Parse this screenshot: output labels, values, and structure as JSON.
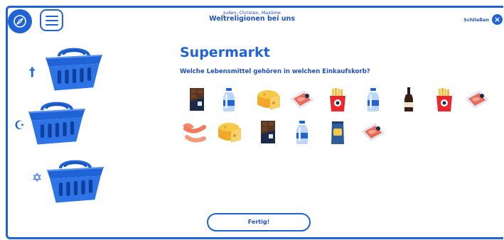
{
  "header": {
    "subtitle": "Juden, Christen, Muslime",
    "title": "Weltreligionen bei uns",
    "close_label": "Schließen",
    "close_glyph": "×"
  },
  "icons": {
    "compass": "compass-icon",
    "menu": "hamburger-menu-icon",
    "close": "close-icon"
  },
  "baskets": [
    {
      "symbol": "†",
      "religion": "christian"
    },
    {
      "symbol": "☪",
      "religion": "muslim"
    },
    {
      "symbol": "✡",
      "religion": "jewish"
    }
  ],
  "main": {
    "title": "Supermarkt",
    "question": "Welche Lebensmittel gehören in welchen Einkaufskorb?"
  },
  "food_items": [
    {
      "kind": "chocolate"
    },
    {
      "kind": "water-bottle"
    },
    {
      "kind": "cheese"
    },
    {
      "kind": "meat-tray"
    },
    {
      "kind": "fries"
    },
    {
      "kind": "water-bottle"
    },
    {
      "kind": "wine-bottle"
    },
    {
      "kind": "fries"
    },
    {
      "kind": "meat-tray"
    },
    {
      "kind": "sausages"
    },
    {
      "kind": "cheese"
    },
    {
      "kind": "chocolate"
    },
    {
      "kind": "water-bottle"
    },
    {
      "kind": "chips-bag"
    },
    {
      "kind": "meat-tray"
    }
  ],
  "done_button": {
    "label": "Fertig!"
  },
  "colors": {
    "primary": "#1f63d6",
    "text": "#1f4fbf"
  }
}
